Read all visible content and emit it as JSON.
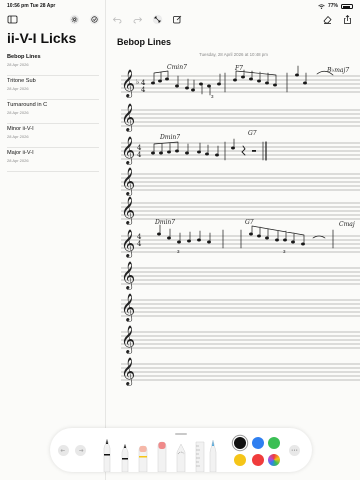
{
  "status_bar": {
    "time_date": "10:56 pm   Tue 28 Apr",
    "battery": "77%"
  },
  "sidebar": {
    "title": "ii-V-I Licks",
    "notes": [
      {
        "title": "Bebop Lines",
        "date": "28 Apr 2026"
      },
      {
        "title": "Tritone Sub",
        "date": "28 Apr 2026"
      },
      {
        "title": "Turnaround in C",
        "date": "28 Apr 2026"
      },
      {
        "title": "Minor ii-V-I",
        "date": "28 Apr 2026"
      },
      {
        "title": "Major ii-V-I",
        "date": "28 Apr 2026"
      }
    ]
  },
  "note": {
    "title": "Bebop Lines",
    "date": "Tuesday, 28 April 2026 at 10:48 pm"
  },
  "score": {
    "chords": [
      {
        "label": "Cmin7"
      },
      {
        "label": "F7"
      },
      {
        "label": "B♭maj7"
      },
      {
        "label": "Dmin7"
      },
      {
        "label": "G7"
      },
      {
        "label": "Dmin7"
      },
      {
        "label": "G7"
      },
      {
        "label": "Cmaj"
      }
    ],
    "time_signature": "4/4"
  },
  "palette": {
    "colors": [
      {
        "name": "black",
        "hex": "#111111",
        "selected": true
      },
      {
        "name": "blue",
        "hex": "#2f7ff0"
      },
      {
        "name": "green",
        "hex": "#3bbf55"
      },
      {
        "name": "yellow",
        "hex": "#f5c518"
      },
      {
        "name": "red",
        "hex": "#f03c3c"
      }
    ],
    "more_label": "···"
  },
  "icons": {
    "sidebar_toggle": "sidebar-icon",
    "settings": "gear-icon",
    "check": "checkmark-circle-icon",
    "undo": "undo-icon",
    "redo": "redo-icon",
    "resize": "resize-arrows-icon",
    "compose": "compose-icon",
    "eraser": "eraser-icon",
    "share": "share-icon"
  }
}
